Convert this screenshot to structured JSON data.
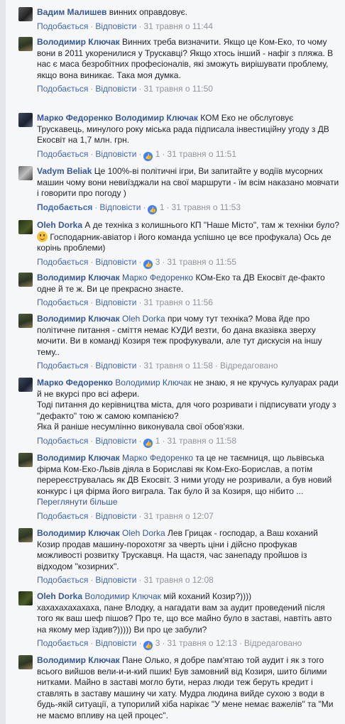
{
  "actions": {
    "like": "Подобається",
    "reply": "Відповісти",
    "edited": "Відредаговано"
  },
  "see_more": "Переглянути більше",
  "comments": [
    {
      "author": "Вадим Малишев",
      "tag": "",
      "text": "винних оправдовує.",
      "time": "31 травня о 11:44",
      "likes": "",
      "edited": false
    },
    {
      "author": "Володимир Ключак",
      "tag": "",
      "text": "Винних треба визначити. Якщо це Ком-Еко, то чому вони в 2011 укоренилися у Трускавці? Якщо хтось інший - нафіг з пляжа. В нас є маса безробітних професіоналів, які зможуть вирішувати проблему, якщо вона виникає. Така моя думка.",
      "time": "31 травня о 11:50",
      "likes": "",
      "edited": false
    },
    {
      "author": "Марко Федоренко",
      "tag": "Володимир Ключак",
      "text": "КОМ Еко не обслуговує Трускавець, минулого року міська рада підписала інвестиційну угоду з ДВ Екосвіт на 1,7 млн. грн.",
      "time": "31 травня о 11:51",
      "likes": "1",
      "edited": false
    },
    {
      "author": "Vadym Beliak",
      "tag": "",
      "text": "Це 100%-ві політичні ігри, Ви запитайте у водіїв мусорних машин чому вони невиїзджали на свої маршрути - їм всім наказано мовчати і говорити про погоду )",
      "time": "31 травня о 11:53",
      "likes": "1",
      "edited": false
    },
    {
      "author": "Oleh Dorka",
      "tag": "",
      "text": "А де техніка з колишнього КП \"Наше Місто\", там ж техніки було?",
      "text2": "Господарник-авіатор і його команда успішно це все профукала) Ось де корінь проблеми)",
      "time": "31 травня о 11:55",
      "likes": "3",
      "edited": false
    },
    {
      "author": "Володимир Ключак",
      "tag": "Марко Федоренко",
      "text": "КОм-Еко та ДВ Екосвіт де-факто одне й те ж. Ви це прекрасно знаєте.",
      "time": "31 травня о 11:56",
      "likes": "",
      "edited": false
    },
    {
      "author": "Володимир Ключак",
      "tag": "Oleh Dorka",
      "text": "при чому тут техніка? Мова йде про політичне питання - сміття немає КУДИ везти, бо дана вказівка зверху мочити. Ви в команді Козиря теж профукували, але тут дискусія на іншу тему..",
      "time": "31 травня о 11:58",
      "likes": "",
      "edited": true
    },
    {
      "author": "Марко Федоренко",
      "tag": "Володимир Ключак",
      "text": "не знаю, я не кручусь кулуарах ради й не вкурсі про всі афери.",
      "text2": "Тоді питання до керівництва міста, для чого розривати і підписувати угоду з \"дефакто\" тою ж самою компанією?",
      "text3": "Яка й раніше несумлінно виконувала свої обов'язки.",
      "time": "31 травня о 11:58",
      "likes": "1",
      "edited": false
    },
    {
      "author": "Володимир Ключак",
      "tag": "Марко Федоренко",
      "text": "та це не таємниця, що львівська фірма Ком-Еко-Львів діяла в Бориславі як Ком-Еко-Борислав, а потім перереєструвалась як ДВ Екосвіт. З ними угоду не розривали, а був новий конкурс і ця фірма його виграла. Так було й за Козиря, що нібито ...",
      "time": "31 травня о 12:07",
      "likes": "",
      "edited": false
    },
    {
      "author": "Володимир Ключак",
      "tag": "Oleh Dorka",
      "text": "Лев Грицак - господар, а Ваш коханий Козир продав машину-порохотяг за чверть ціни і дійсно профукав можливості розвитку Трускавця. На щастя, час занепаду пройшов із відходом \"козирних\".",
      "time": "31 травня о 12:08",
      "likes": "",
      "edited": false
    },
    {
      "author": "Oleh Dorka",
      "tag": "Володимир Ключак",
      "text": "мій коханий Козир?))))",
      "text2": "хахахахахахаха, пане Влодку, а нагадати вам за аудит проведений після того як ваш шеф пішов? Про те, що все майно було в заставі, навтіть авто на якому мер їздив?))))) Ви про це забули?",
      "time": "31 травня о 12:13",
      "likes": "3",
      "edited": true
    },
    {
      "author": "Володимир Ключак",
      "tag": "",
      "text": "Пане Олько, я добре пам'ятаю той аудит і як з того всього вийшов вели-и-и-кий пшик! Був замовний від Козиря, шито білими нитками. Майно в заставі могло бути, нераз люди теж беруть кредит і ставлять в заставу машину чи хату. Мудра людина вийде сухою з води в будь-якій ситуації, а тупорилий хіба нарікає \"У мене немає важелів\" та \"Ми не маємо впливу на цей процес\".",
      "time": "",
      "likes": "",
      "edited": false
    }
  ],
  "colors": {
    "link": "#365899",
    "meta": "#90949c",
    "like_badge": "#4080ff",
    "background": "#f6f7f9"
  }
}
